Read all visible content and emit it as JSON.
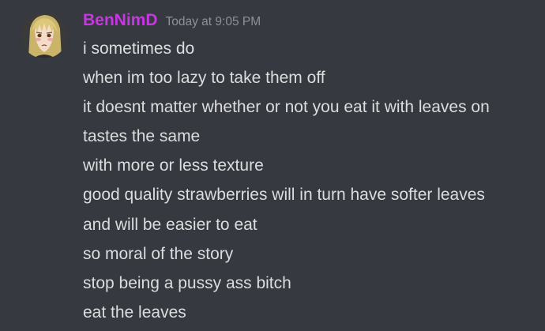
{
  "message": {
    "author": {
      "username": "BenNimD",
      "name_color": "#c836e3",
      "avatar_icon": "anime-character-avatar"
    },
    "timestamp": "Today at 9:05 PM",
    "lines": [
      "i sometimes do",
      "when im too lazy to take them off",
      "it doesnt matter whether or not you eat it with leaves on",
      "tastes the same",
      "with more or less texture",
      "good quality strawberries will in turn have softer leaves",
      "and will be easier to eat",
      "so moral of the story",
      "stop being a pussy ass bitch",
      "eat the leaves"
    ]
  },
  "theme": {
    "background": "#36393f",
    "text": "#dcddde",
    "muted": "#8e9297"
  }
}
